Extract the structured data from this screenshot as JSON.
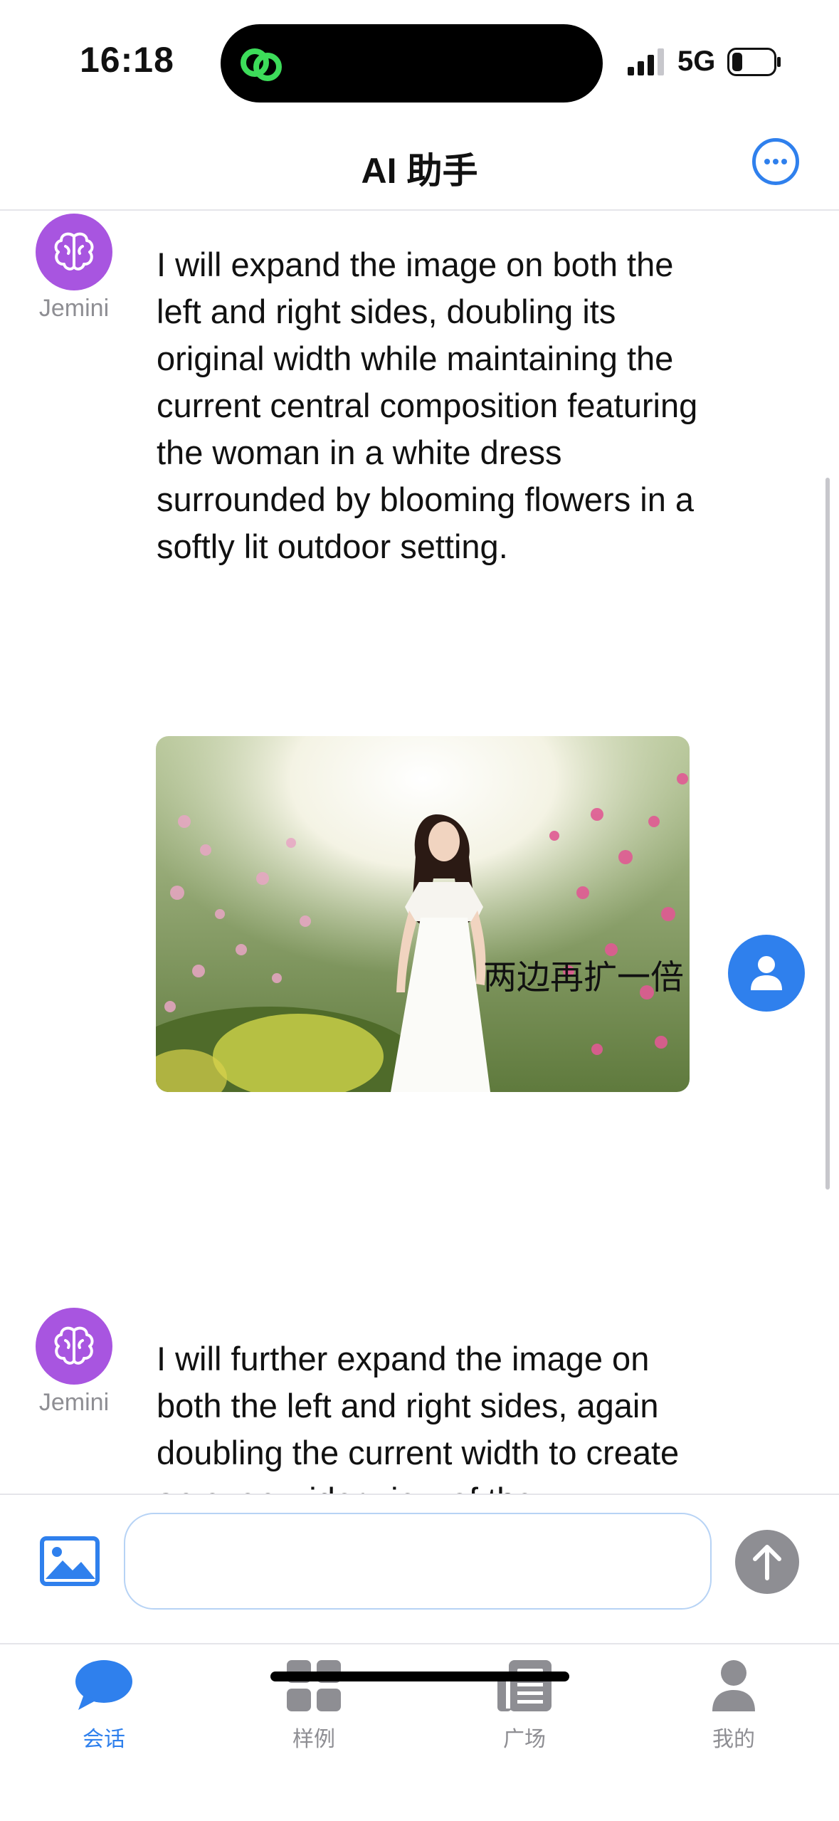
{
  "status_bar": {
    "time": "16:18",
    "network": "5G"
  },
  "nav": {
    "title": "AI 助手"
  },
  "messages": {
    "bot1": {
      "name": "Jemini",
      "text": "I will expand the image on both the left and right sides, doubling its original width while maintaining the current central composition featuring the woman in a white dress surrounded by blooming flowers in a softly lit outdoor setting."
    },
    "user1": {
      "text": "两边再扩一倍"
    },
    "bot2": {
      "name": "Jemini",
      "text": "I will further expand the image on both the left and right sides, again doubling the current width to create an even wider view of the"
    }
  },
  "input": {
    "placeholder": ""
  },
  "tabs": [
    {
      "label": "会话",
      "icon": "chat-bubble-icon",
      "active": true
    },
    {
      "label": "样例",
      "icon": "grid-icon",
      "active": false
    },
    {
      "label": "广场",
      "icon": "newspaper-icon",
      "active": false
    },
    {
      "label": "我的",
      "icon": "person-icon",
      "active": false
    }
  ],
  "colors": {
    "accent": "#2f80ed",
    "bot_avatar": "#a855e0",
    "send_disabled": "#8e8e93",
    "input_border": "#b7d3f5"
  }
}
